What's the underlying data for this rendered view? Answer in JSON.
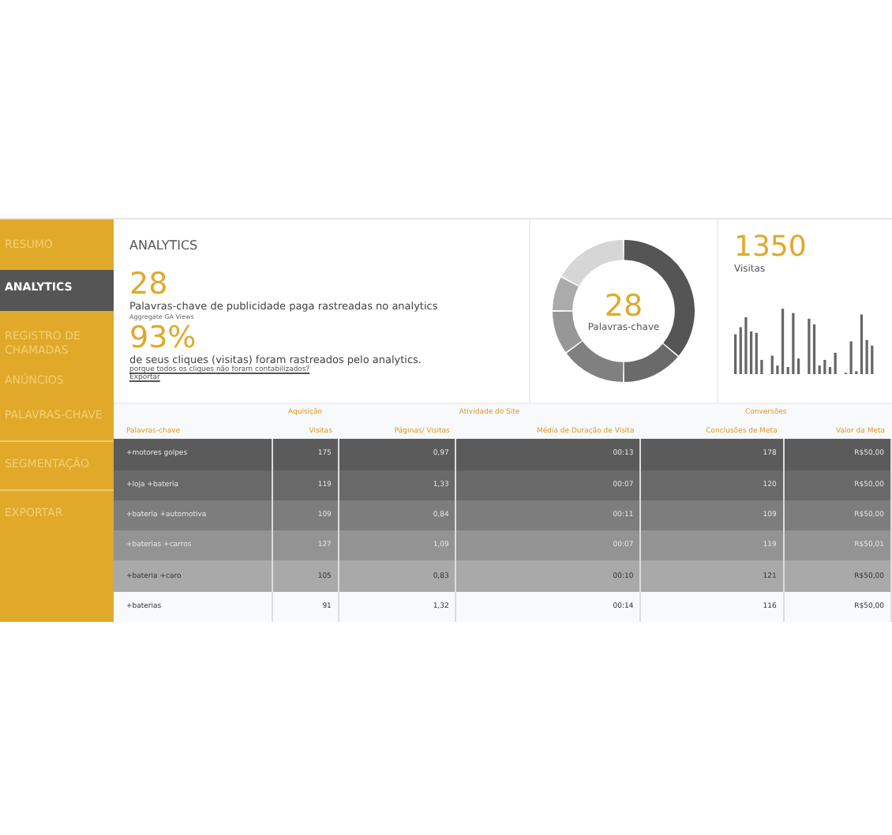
{
  "sidebar": {
    "items": [
      {
        "label": "RESUMO",
        "selected": false
      },
      {
        "label": "ANALYTICS",
        "selected": true
      },
      {
        "label": "REGISTRO DE CHAMADAS",
        "selected": false
      },
      {
        "label": "ANÚNCIOS",
        "selected": false
      },
      {
        "label": "PALAVRAS-CHAVE",
        "selected": false
      },
      {
        "label": "SEGMENTAÇÃO",
        "selected": false
      },
      {
        "label": "EXPORTAR",
        "selected": false
      }
    ]
  },
  "summary": {
    "title": "ANALYTICS",
    "keywords_count": "28",
    "keywords_text": "Palavras-chave de publicidade paga rastreadas no analytics",
    "keywords_note": "Aggregate GA Views",
    "percent": "93%",
    "percent_text": "de seus cliques (visitas) foram rastreados pelo analytics.",
    "why_link": "porque todos os cliques não foram contabilizados?",
    "export_link": "Exportar"
  },
  "donut": {
    "value": "28",
    "label": "Palavras-chave"
  },
  "visits": {
    "value": "1350",
    "label": "Visitas"
  },
  "table": {
    "groups": [
      "Aquisição",
      "Atividade do Site",
      "Conversões"
    ],
    "columns": [
      "Palavras-chave",
      "Visitas",
      "Páginas/ Visitas",
      "Média de Duração de Visita",
      "Conclusões de Meta",
      "Valor da Meta"
    ],
    "rows": [
      {
        "color": "#5b5b5b",
        "cells": [
          "+motores golpes",
          "175",
          "0,97",
          "00:13",
          "178",
          "R$50,00"
        ]
      },
      {
        "color": "#696969",
        "cells": [
          "+loja +bateria",
          "119",
          "1,33",
          "00:07",
          "120",
          "R$50,00"
        ]
      },
      {
        "color": "#7d7d7d",
        "cells": [
          "+bateria +automotiva",
          "109",
          "0,84",
          "00:11",
          "109",
          "R$50,00"
        ]
      },
      {
        "color": "#939393",
        "cells": [
          "+baterias +carros",
          "127",
          "1,09",
          "00:07",
          "119",
          "R$50,01"
        ]
      },
      {
        "color": "#a9a9a9",
        "cells": [
          "+bateria +caro",
          "105",
          "0,83",
          "00:10",
          "121",
          "R$50,00"
        ]
      },
      {
        "color": "#f8f9fb",
        "cells": [
          "+baterias",
          "91",
          "1,32",
          "00:14",
          "116",
          "R$50,00"
        ]
      }
    ]
  }
}
